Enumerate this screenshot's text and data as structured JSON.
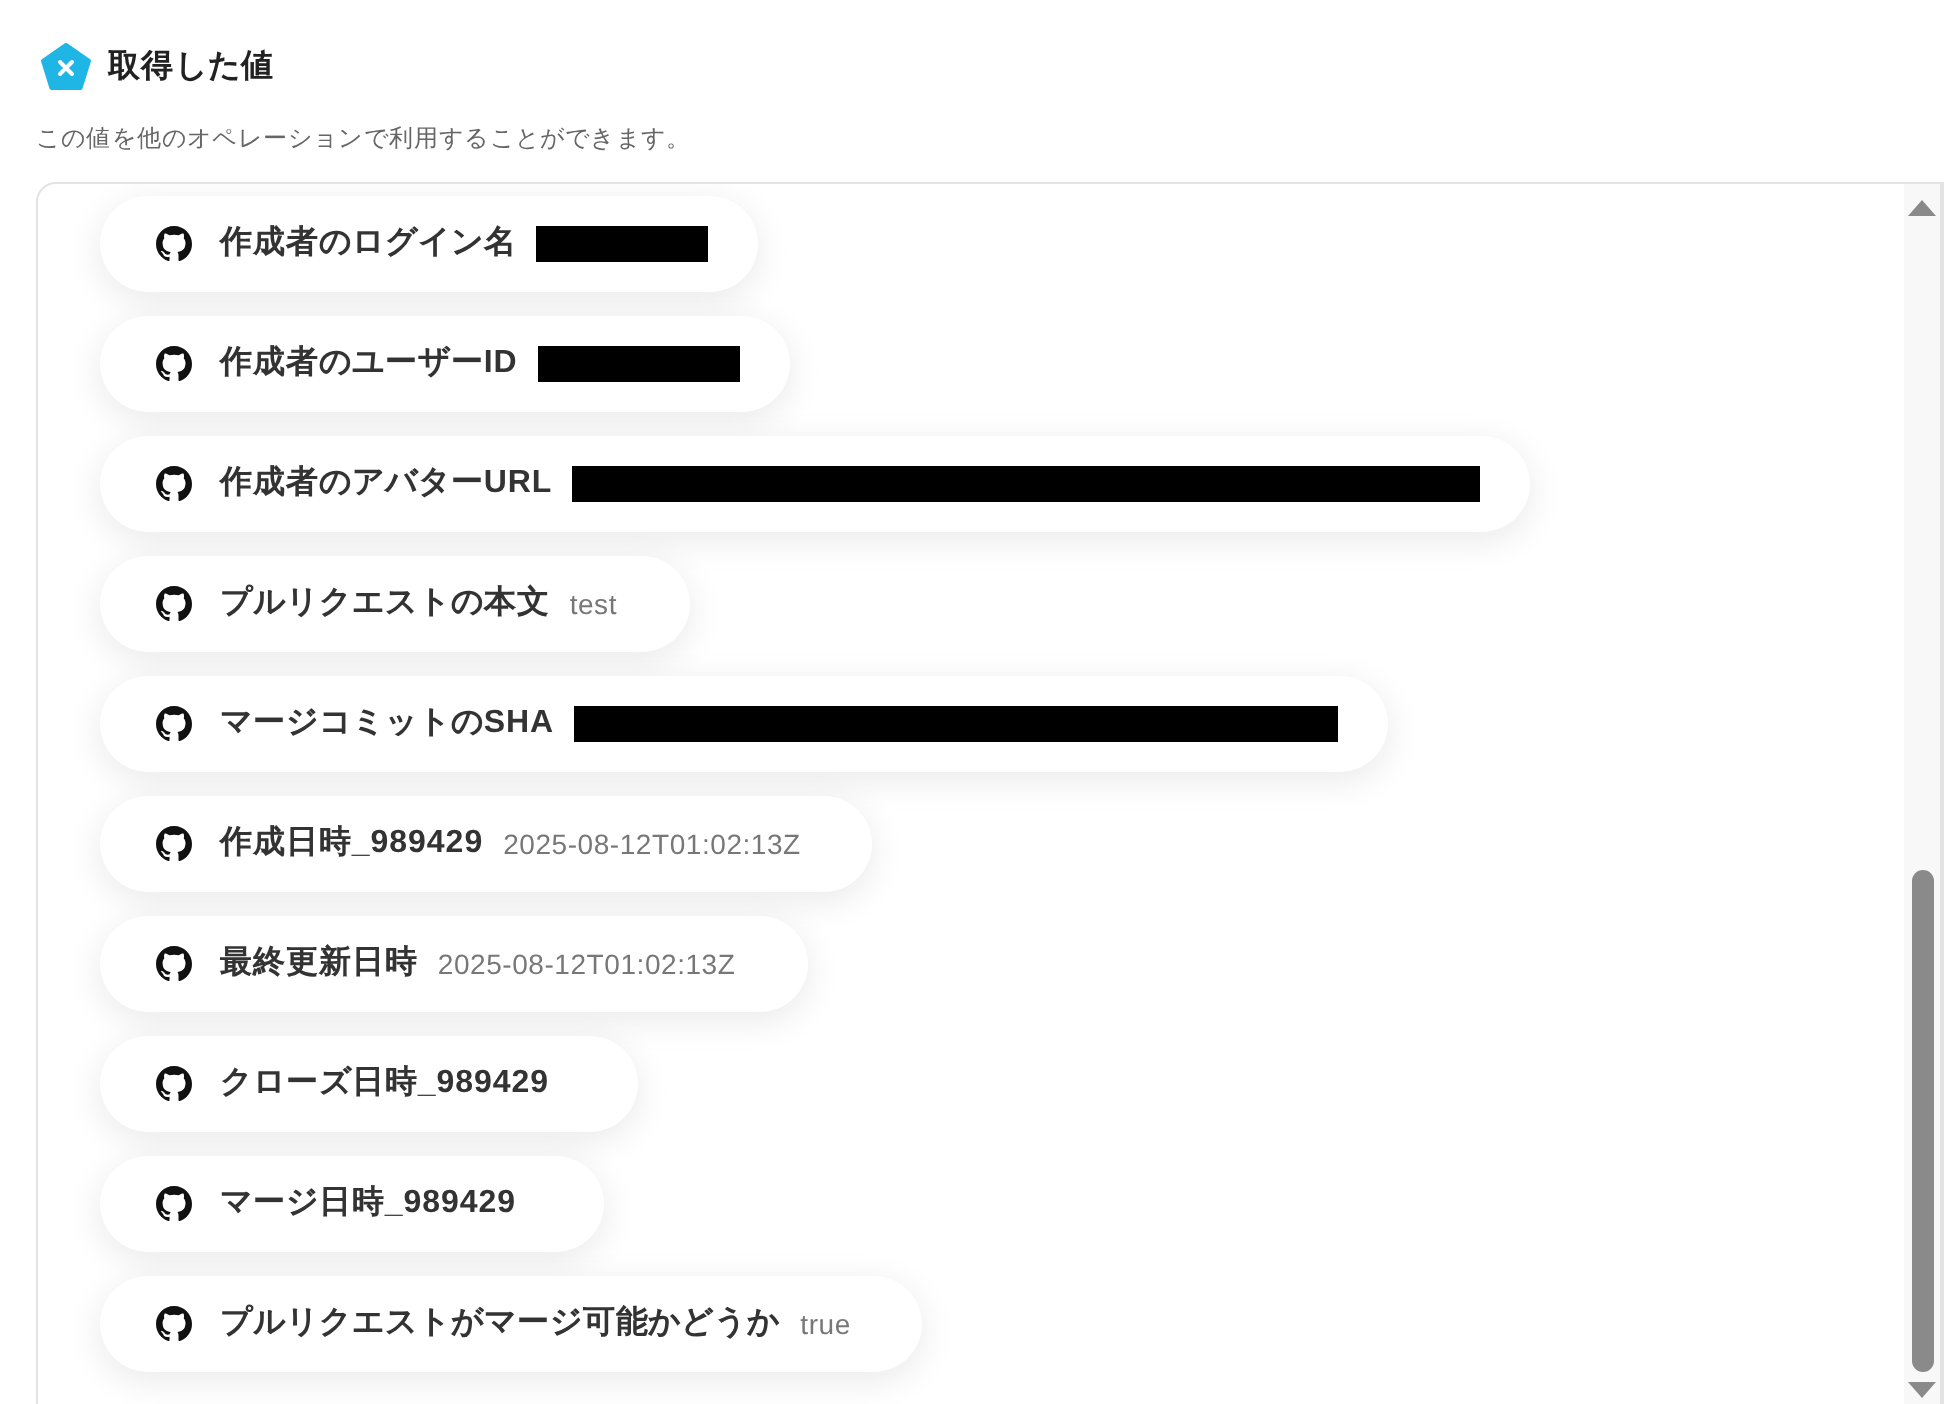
{
  "header": {
    "title": "取得した値",
    "description": "この値を他のオペレーションで利用することができます。"
  },
  "values": [
    {
      "label": "作成者のログイン名",
      "kind": "redacted"
    },
    {
      "label": "作成者のユーザーID",
      "kind": "redacted"
    },
    {
      "label": "作成者のアバターURL",
      "kind": "redacted"
    },
    {
      "label": "プルリクエストの本文",
      "kind": "text",
      "value": "test"
    },
    {
      "label": "マージコミットのSHA",
      "kind": "redacted"
    },
    {
      "label": "作成日時_989429",
      "kind": "text",
      "value": "2025-08-12T01:02:13Z"
    },
    {
      "label": "最終更新日時",
      "kind": "text",
      "value": "2025-08-12T01:02:13Z"
    },
    {
      "label": "クローズ日時_989429",
      "kind": "empty"
    },
    {
      "label": "マージ日時_989429",
      "kind": "empty"
    },
    {
      "label": "プルリクエストがマージ可能かどうか",
      "kind": "text",
      "value": "true"
    }
  ]
}
